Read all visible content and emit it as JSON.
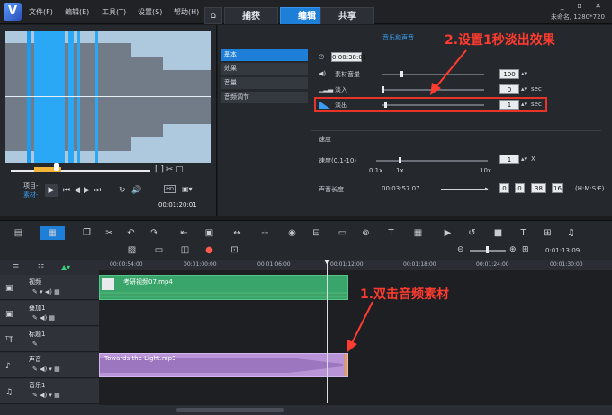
{
  "menu": [
    "文件(F)",
    "编辑(E)",
    "工具(T)",
    "设置(S)",
    "帮助(H)"
  ],
  "tabs": [
    "捕获",
    "编辑",
    "共享"
  ],
  "active_tab": "编辑",
  "project_info": "未命名, 1280*720",
  "preview": {
    "project_label": "项目-",
    "clip_label": "素材-",
    "timecode": "00:01:20:01",
    "size_label": "HD"
  },
  "props": {
    "header": "音乐和声音",
    "side_tabs": [
      "基本",
      "效果",
      "音量",
      "音频调节"
    ],
    "duration": "0:00:38:01",
    "volume_label": "素材音量",
    "volume_value": "100",
    "fade_in_label": "淡入",
    "fade_in_value": "0",
    "fade_out_label": "淡出",
    "fade_out_value": "1",
    "sec": "sec",
    "speed_section": "速度",
    "speed_label": "速度(0.1-10)",
    "speed_value": "1",
    "speed_unit": "X",
    "speed_marks": [
      "0.1x",
      "1x",
      "10x"
    ],
    "audio_len_label": "声音长度",
    "audio_len_value": "00:03:57.07",
    "len_fields": [
      "0",
      "0",
      "38",
      "16"
    ],
    "len_format": "(H:M:S:F)"
  },
  "annotations": {
    "step2": "2.设置1秒淡出效果",
    "step1": "1.双击音频素材"
  },
  "timeline": {
    "timecode": "0:01:13:09",
    "ruler": [
      "00:00:54:00",
      "00:01:00:00",
      "00:01:06:00",
      "00:01:12:00",
      "00:01:18:00",
      "00:01:24:00",
      "00:01:30:00"
    ],
    "tracks": [
      "视频",
      "叠加1",
      "标题1",
      "声音",
      "音乐1"
    ],
    "video_clip": "考研视频07.mp4",
    "audio_clip": "Towards the Light.mp3"
  },
  "colors": {
    "accent": "#1e7fd8",
    "annotation": "#ff3b2f",
    "video_clip": "#3aa56a",
    "audio_clip": "#b995d8"
  }
}
